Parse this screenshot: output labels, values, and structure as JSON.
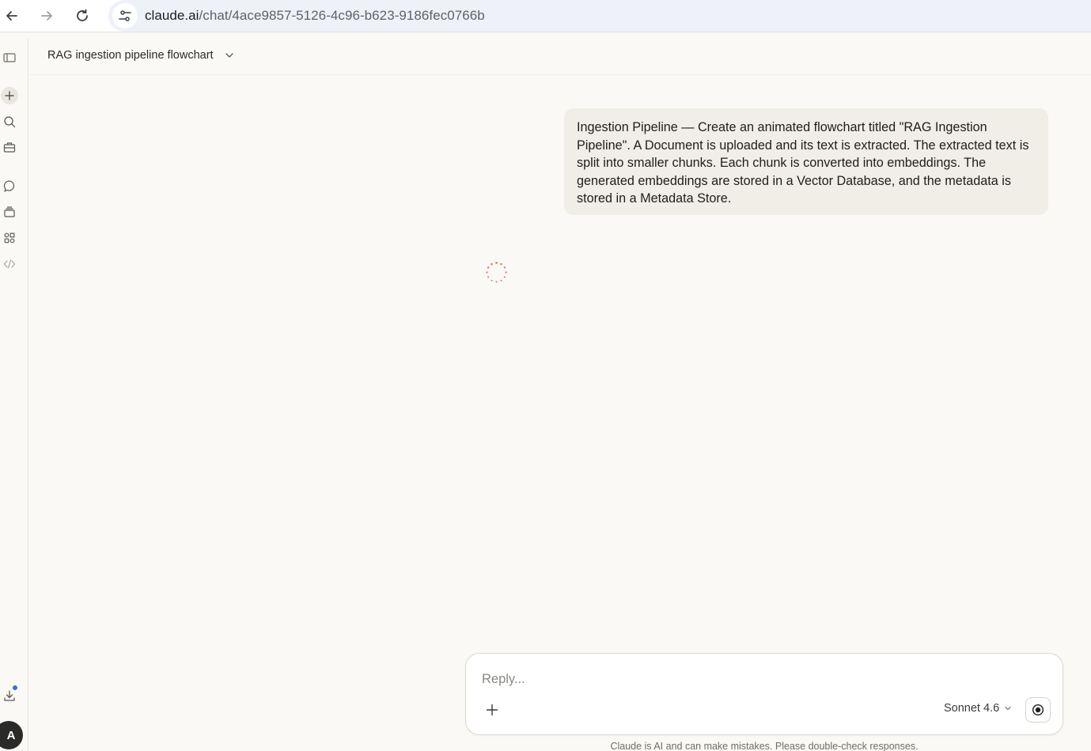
{
  "browser": {
    "url_domain": "claude.ai",
    "url_path": "/chat/4ace9857-5126-4c96-b623-9186fec0766b",
    "icons": [
      "back-arrow-icon",
      "forward-arrow-icon",
      "reload-icon",
      "site-settings-icon"
    ]
  },
  "sidebar": {
    "icons": [
      "sidebar-toggle-icon",
      "new-chat-icon",
      "search-icon",
      "toolbox-icon",
      "chats-icon",
      "projects-icon",
      "artifacts-icon",
      "code-icon",
      "download-icon"
    ],
    "avatar_initial": "A"
  },
  "header": {
    "title": "RAG ingestion pipeline flowchart"
  },
  "conversation": {
    "user_message": "Ingestion Pipeline — Create an animated flowchart titled \"RAG Ingestion Pipeline\". A Document is uploaded and its text is extracted. The extracted text is split into smaller chunks. Each chunk is converted into embeddings. The generated embeddings are stored in a Vector Database, and the metadata is stored in a Metadata Store."
  },
  "composer": {
    "placeholder": "Reply...",
    "model": "Sonnet 4.6"
  },
  "footer": {
    "disclaimer": "Claude is AI and can make mistakes. Please double-check responses."
  },
  "colors": {
    "background": "#faf9f5",
    "message_bubble": "#f0eee6",
    "spinner": "#d97757",
    "notification": "#2f6fe4"
  }
}
